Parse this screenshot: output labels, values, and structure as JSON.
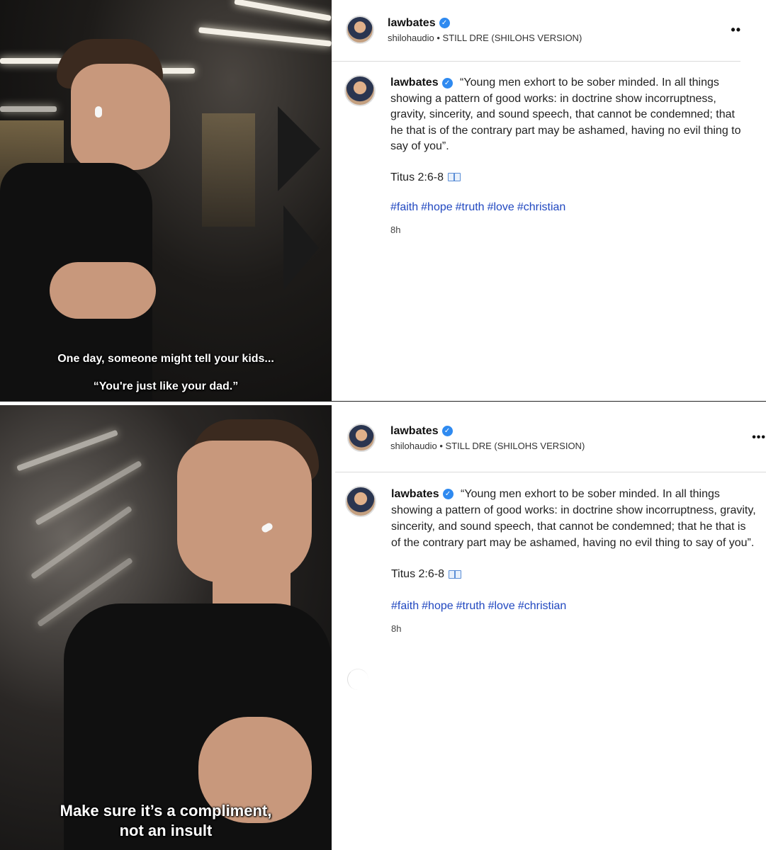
{
  "panels": [
    {
      "captions": [
        "One day, someone might tell your kids...",
        "“You're just like your dad.”"
      ],
      "header": {
        "username": "lawbates",
        "audio": "shilohaudio • STILL DRE (SHILOHS VERSION)",
        "more": "••"
      },
      "post": {
        "username": "lawbates",
        "text": "“Young men exhort to be sober minded. In all things showing a pattern of good works: in doctrine show incorruptness, gravity, sincerity, and sound speech, that cannot be condemned; that he that is of the contrary part may be ashamed, having no evil thing to say of you”.",
        "citation": "Titus 2:6-8",
        "hashtags": [
          "#faith",
          "#hope",
          "#truth",
          "#love",
          "#christian"
        ],
        "time": "8h"
      }
    },
    {
      "captions": [
        "Make sure it’s a compliment,",
        "not an insult"
      ],
      "header": {
        "username": "lawbates",
        "audio": "shilohaudio • STILL DRE (SHILOHS VERSION)",
        "more": "•••"
      },
      "post": {
        "username": "lawbates",
        "text": "“Young men exhort to be sober minded. In all things showing a pattern of good works: in doctrine show incorruptness, gravity, sincerity, and sound speech, that cannot be condemned; that he that is of the contrary part may be ashamed, having no evil thing to say of you”.",
        "citation": "Titus 2:6-8",
        "hashtags": [
          "#faith",
          "#hope",
          "#truth",
          "#love",
          "#christian"
        ],
        "time": "8h"
      }
    }
  ],
  "colors": {
    "verified": "#2f8af0",
    "hashtag": "#2148c0"
  }
}
